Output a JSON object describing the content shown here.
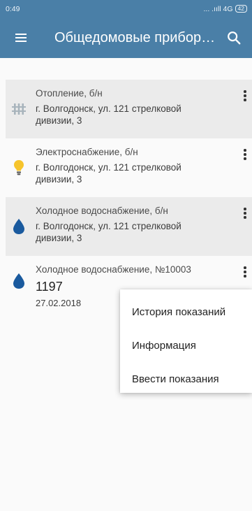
{
  "status_bar": {
    "time": "0:49",
    "network": "... .ııll 4G",
    "battery": "42"
  },
  "app_bar": {
    "title": "Общедомовые прибор…",
    "menu_icon": "hamburger-menu-icon",
    "search_icon": "search-icon"
  },
  "meters": [
    {
      "name": "Отопление, б/н",
      "address": "г. Волгодонск, ул. 121 стрелковой дивизии, 3",
      "icon": "radiator-icon",
      "color": "#a8b4bc"
    },
    {
      "name": "Электроснабжение, б/н",
      "address": "г. Волгодонск, ул. 121 стрелковой дивизии, 3",
      "icon": "lightbulb-icon",
      "color": "#f6c42c"
    },
    {
      "name": "Холодное водоснабжение, б/н",
      "address": "г. Волгодонск, ул. 121 стрелковой дивизии, 3",
      "icon": "water-drop-icon",
      "color": "#1a5a9e"
    },
    {
      "name": "Холодное водоснабжение, №10003",
      "reading": "1197",
      "date": "27.02.2018",
      "icon": "water-drop-icon",
      "color": "#1a5a9e"
    }
  ],
  "context_menu": {
    "items": [
      "История показаний",
      "Информация",
      "Ввести показания"
    ]
  },
  "colors": {
    "primary": "#4a7fa7",
    "row_shade": "#ebebeb"
  }
}
